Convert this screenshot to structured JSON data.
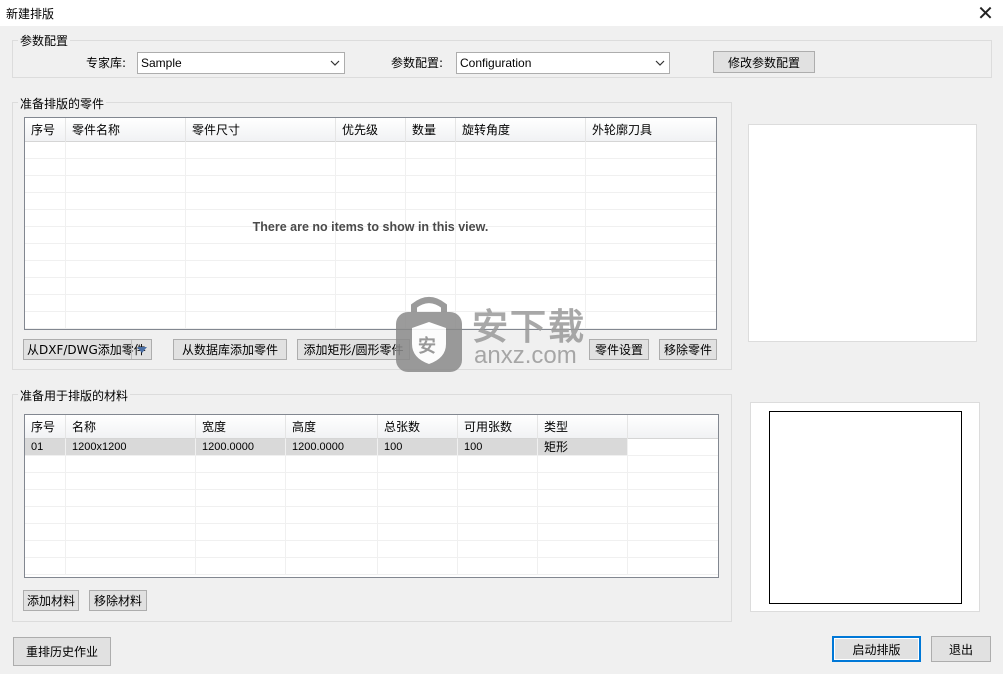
{
  "window": {
    "title": "新建排版",
    "close_glyph": "✕"
  },
  "params": {
    "group_label": "参数配置",
    "expert_label": "专家库:",
    "expert_value": "Sample",
    "config_label": "参数配置:",
    "config_value": "Configuration",
    "modify_button": "修改参数配置"
  },
  "parts": {
    "group_label": "准备排版的零件",
    "columns": [
      "序号",
      "零件名称",
      "零件尺寸",
      "优先级",
      "数量",
      "旋转角度",
      "外轮廓刀具"
    ],
    "empty_message": "There are no items to show in this view.",
    "add_dxf_button": "从DXF/DWG添加零件",
    "add_db_button": "从数据库添加零件",
    "add_shape_button": "添加矩形/圆形零件",
    "settings_button": "零件设置",
    "remove_button": "移除零件"
  },
  "materials": {
    "group_label": "准备用于排版的材料",
    "columns": [
      "序号",
      "名称",
      "宽度",
      "高度",
      "总张数",
      "可用张数",
      "类型"
    ],
    "rows": [
      [
        "01",
        "1200x1200",
        "1200.0000",
        "1200.0000",
        "100",
        "100",
        "矩形"
      ]
    ],
    "add_button": "添加材料",
    "remove_button": "移除材料"
  },
  "footer": {
    "history_button": "重排历史作业",
    "start_button": "启动排版",
    "exit_button": "退出"
  },
  "watermark": {
    "brand": "安下载",
    "url": "anxz.com",
    "shield_glyph": "安"
  }
}
